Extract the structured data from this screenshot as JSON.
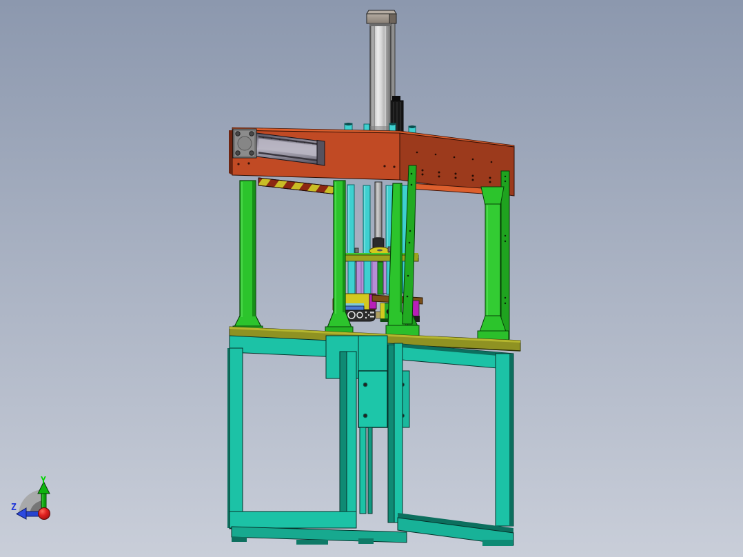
{
  "viewport": {
    "type": "3d-cad-viewport",
    "model_description": "press machine assembly 3D model",
    "background_top": "#8c98ae",
    "background_bottom": "#c9ced9"
  },
  "triad": {
    "y_label": "Y",
    "z_label": "Z",
    "y_color": "#00d400",
    "z_color": "#2338d8",
    "origin_color": "#cc1111"
  },
  "colors": {
    "orange_front": "#c14a24",
    "orange_side": "#9c3a1c",
    "orange_top": "#dd5f2d",
    "hazard_yellow": "#c9bd26",
    "hazard_red": "#8c2812",
    "green_main": "#2cc42c",
    "green_shade": "#1a9a1a",
    "cyan_rod": "#3ed0d0",
    "teal_main": "#1cc2a6",
    "teal_shade": "#0c6f5e",
    "olive_top": "#8f9222",
    "purple_plate": "#b78ed6",
    "magenta": "#b81fb8",
    "yellow_part": "#d3c91f",
    "gray_metal": "#8c8c8c",
    "die_dark": "#2d2d2d",
    "axis_green": "#00d400",
    "axis_blue": "#2338d8",
    "axis_red": "#cc1111",
    "bg_top": "#8c98ae",
    "bg_bottom": "#c9ced9"
  },
  "parts": [
    {
      "name": "pneumatic-cylinder",
      "color": "#c9c9c9"
    },
    {
      "name": "cylinder-cap",
      "color": "#958b80"
    },
    {
      "name": "solenoid-valve",
      "color": "#1c1c1c"
    },
    {
      "name": "top-plate-front",
      "color": "#c14a24"
    },
    {
      "name": "top-plate-side",
      "color": "#9c3a1c"
    },
    {
      "name": "linear-rail",
      "color": "#9b98a6"
    },
    {
      "name": "rail-mount-plate",
      "color": "#8c8c8c"
    },
    {
      "name": "hazard-stripe-band",
      "colors": [
        "#c9bd26",
        "#8c2812"
      ]
    },
    {
      "name": "support-columns",
      "color": "#2cc42c"
    },
    {
      "name": "guide-rods",
      "color": "#3ed0d0"
    },
    {
      "name": "piston-rod",
      "color": "#b9b9b9"
    },
    {
      "name": "moving-platen",
      "color": "#9aa41e"
    },
    {
      "name": "die-plates",
      "color": "#b78ed6"
    },
    {
      "name": "die-block",
      "color": "#2d2d2d"
    },
    {
      "name": "work-table-top",
      "color": "#8f9222"
    },
    {
      "name": "base-frame",
      "color": "#1cc2a6"
    }
  ]
}
